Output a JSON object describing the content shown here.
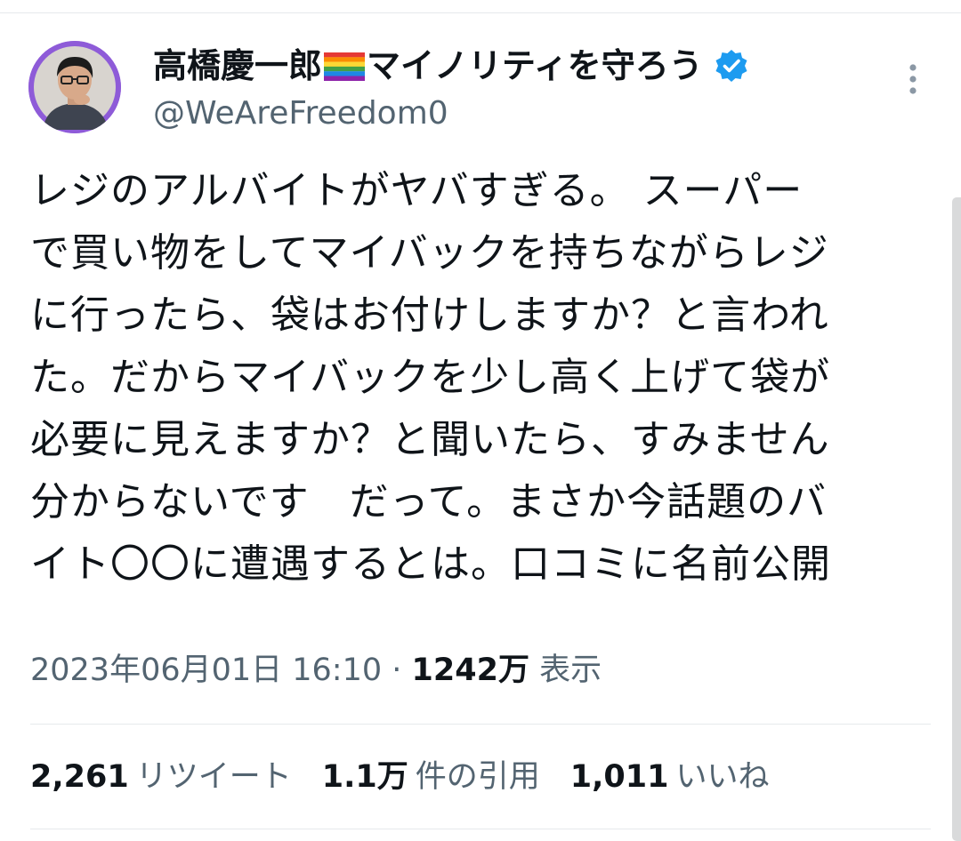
{
  "user": {
    "display_name_prefix": "高橋慶一郎",
    "display_name_suffix": "マイノリティを守ろう",
    "flag_icon": "rainbow-flag-icon",
    "verified_icon": "verified-badge-icon",
    "verified_color": "#1d9bf0",
    "handle": "@WeAreFreedom0",
    "avatar_ring_color": "#8e5bd8"
  },
  "tweet": {
    "lines": [
      "レジのアルバイトがヤバすぎる。 スーパー",
      "で買い物をしてマイバックを持ちながらレジ",
      "に行ったら、袋はお付けしますか？と言われ",
      "た。だからマイバックを少し高く上げて袋が",
      "必要に見えますか？と聞いたら、すみません",
      "分からないです　だって。まさか今話題のバ",
      "イト〇〇に遭遇するとは。口コミに名前公開"
    ]
  },
  "meta": {
    "timestamp": "2023年06月01日 16:10",
    "separator": " · ",
    "views_count": "1242万",
    "views_label": " 表示"
  },
  "stats": {
    "retweets_count": "2,261",
    "retweets_label": "リツイート",
    "quotes_count": "1.1万",
    "quotes_label": "件の引用",
    "likes_count": "1,011",
    "likes_label": "いいね"
  },
  "more_icon": "more-vertical-icon"
}
